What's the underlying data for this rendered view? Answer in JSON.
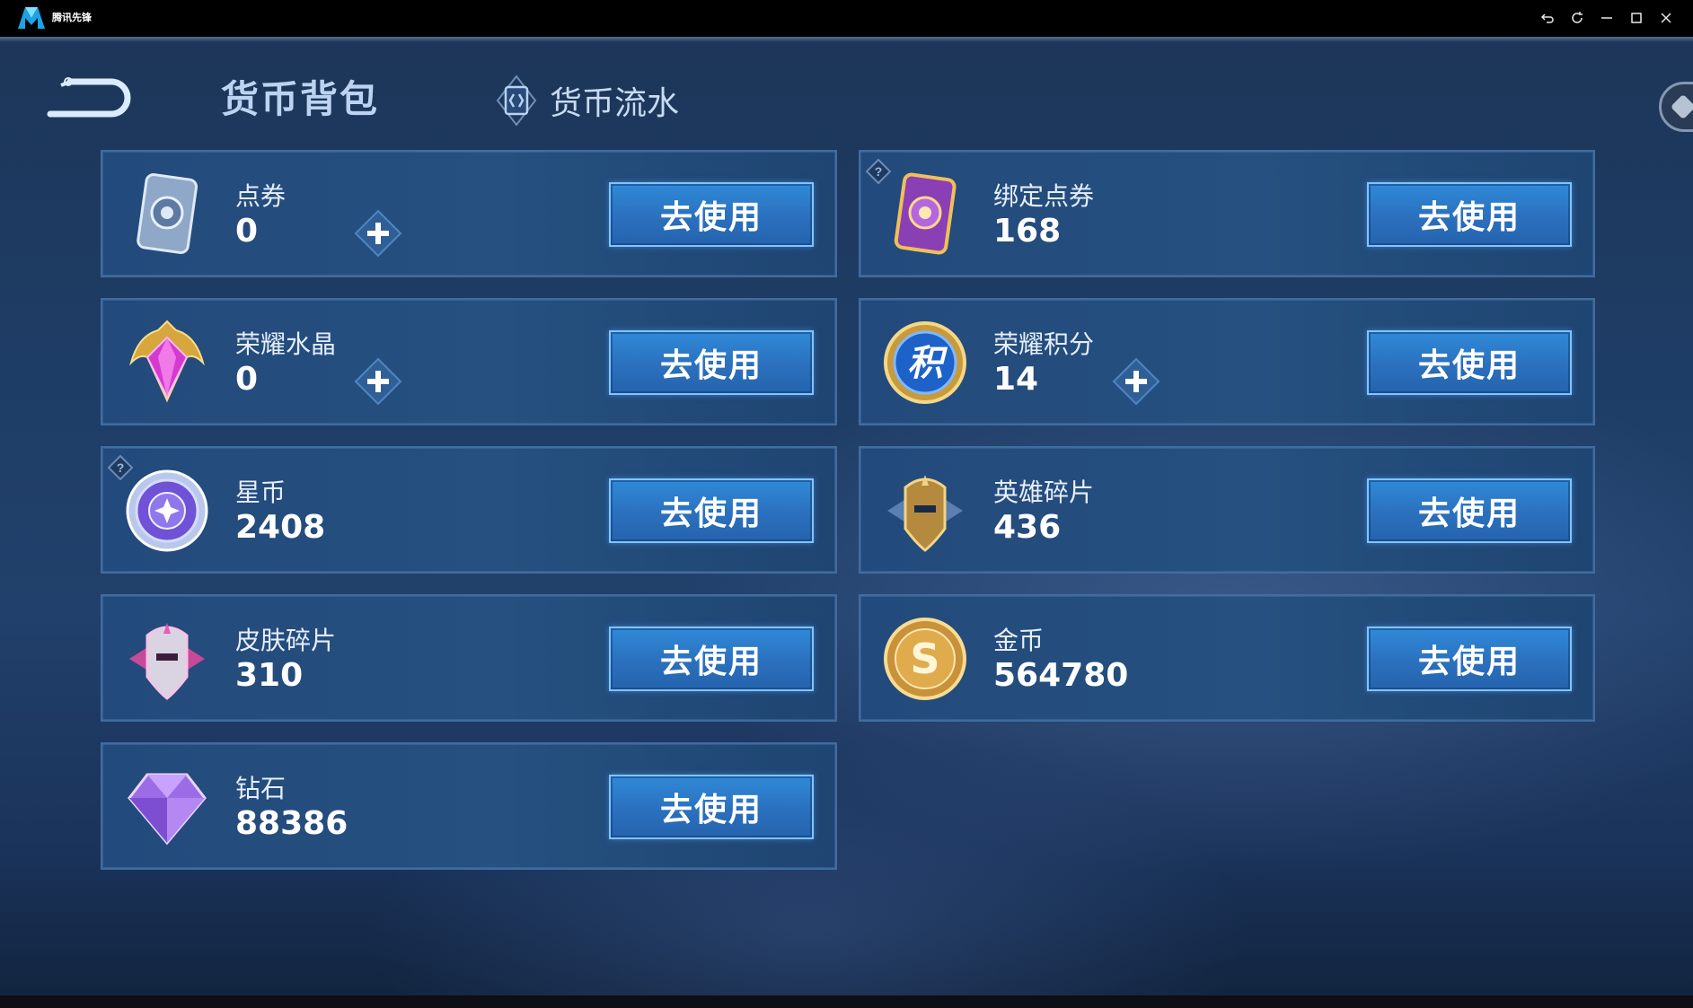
{
  "app": {
    "logo_text": "腾讯先锋",
    "window_controls": [
      "back-icon",
      "refresh-icon",
      "minimize-icon",
      "maximize-icon",
      "close-icon"
    ]
  },
  "header": {
    "title": "货币背包",
    "tab_flow_label": "货币流水"
  },
  "colors": {
    "accent_button": "#2b70be",
    "card_bg": "#234a7c",
    "title_text": "#bcd4f2"
  },
  "currencies": [
    {
      "name": "点券",
      "amount": "0",
      "has_plus": true,
      "has_help": false,
      "button": "去使用",
      "icon": "voucher-card-icon"
    },
    {
      "name": "绑定点券",
      "amount": "168",
      "has_plus": false,
      "has_help": true,
      "button": "去使用",
      "icon": "bound-voucher-card-icon"
    },
    {
      "name": "荣耀水晶",
      "amount": "0",
      "has_plus": true,
      "has_help": false,
      "button": "去使用",
      "icon": "glory-crystal-icon"
    },
    {
      "name": "荣耀积分",
      "amount": "14",
      "has_plus": true,
      "has_help": false,
      "button": "去使用",
      "icon": "glory-points-icon"
    },
    {
      "name": "星币",
      "amount": "2408",
      "has_plus": false,
      "has_help": true,
      "button": "去使用",
      "icon": "star-coin-icon"
    },
    {
      "name": "英雄碎片",
      "amount": "436",
      "has_plus": false,
      "has_help": false,
      "button": "去使用",
      "icon": "hero-fragment-icon"
    },
    {
      "name": "皮肤碎片",
      "amount": "310",
      "has_plus": false,
      "has_help": false,
      "button": "去使用",
      "icon": "skin-fragment-icon"
    },
    {
      "name": "金币",
      "amount": "564780",
      "has_plus": false,
      "has_help": false,
      "button": "去使用",
      "icon": "gold-coin-icon"
    },
    {
      "name": "钻石",
      "amount": "88386",
      "has_plus": false,
      "has_help": false,
      "button": "去使用",
      "icon": "diamond-icon"
    }
  ]
}
